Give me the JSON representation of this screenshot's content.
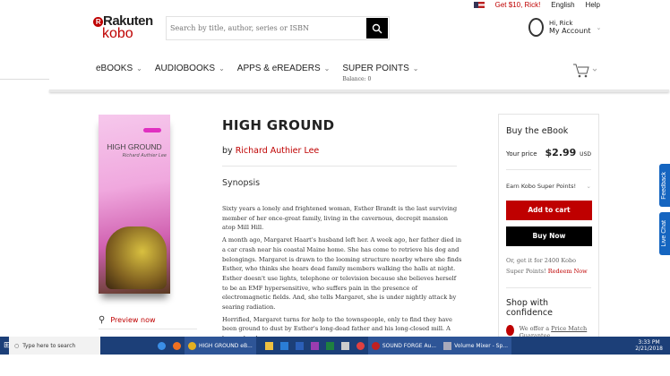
{
  "utility": {
    "promo": "Get $10, Rick!",
    "language": "English",
    "help": "Help"
  },
  "logo": {
    "line1": "Rakuten",
    "line2": "kobo",
    "mark": "R"
  },
  "search": {
    "placeholder": "Search by title, author, series or ISBN",
    "value": ""
  },
  "account": {
    "greeting": "Hi, Rick",
    "label": "My Account"
  },
  "nav": [
    {
      "label": "eBOOKS"
    },
    {
      "label": "AUDIOBOOKS"
    },
    {
      "label": "APPS & eREADERS"
    },
    {
      "label": "SUPER POINTS",
      "sub": "Balance: 0"
    }
  ],
  "book": {
    "title": "HIGH GROUND",
    "by": "by",
    "author": "Richard Authier Lee",
    "cover_title": "HIGH GROUND",
    "cover_author": "Richard Authier Lee",
    "preview": "Preview now",
    "synopsis_heading": "Synopsis",
    "synopsis": [
      "Sixty years a lonely and frightened woman, Esther Brandt is the last surviving member of her once-great family, living in the cavernous, decrepit mansion atop Mill Hill.",
      "A month ago, Margaret Haart's husband left her. A week ago, her father died in a car crash near his coastal Maine home. She has come to retrieve his dog and belongings. Margaret is drawn to the looming structure nearby where she finds Esther, who thinks she hears dead family members walking the halls at night. Esther doesn't use lights, telephone or television because she believes herself to be an EMF hypersensitive, who suffers pain in the presence of electromagnetic fields. And, she tells Margaret, she is under nightly attack by searing radiation.",
      "Horrified, Margaret turns for help to the townspeople, only to find they have been ground to dust by Esther's long-dead father and his long-closed mill. A brassy local"
    ]
  },
  "buy": {
    "heading": "Buy the eBook",
    "price_label": "Your price",
    "price": "$2.99",
    "currency": "USD",
    "earn": "Earn Kobo Super Points!",
    "add_to_cart": "Add to cart",
    "buy_now": "Buy Now",
    "or_text": "Or, get it for 2400 Kobo Super Points!",
    "redeem": "Redeem Now",
    "confidence": "Shop with confidence",
    "price_match_prefix": "We offer a",
    "price_match": "Price Match Guarantee"
  },
  "side_tabs": [
    "Feedback",
    "Live Chat"
  ],
  "taskbar": {
    "search": "Type here to search",
    "chrome": "HIGH GROUND eB...",
    "soundforge": "SOUND FORGE Au...",
    "volume": "Volume Mixer - Sp...",
    "time": "3:33 PM",
    "date": "2/21/2018"
  },
  "colors": {
    "brand": "#bf0000",
    "taskbar": "#1c3f78",
    "side_tab": "#1565c0"
  }
}
